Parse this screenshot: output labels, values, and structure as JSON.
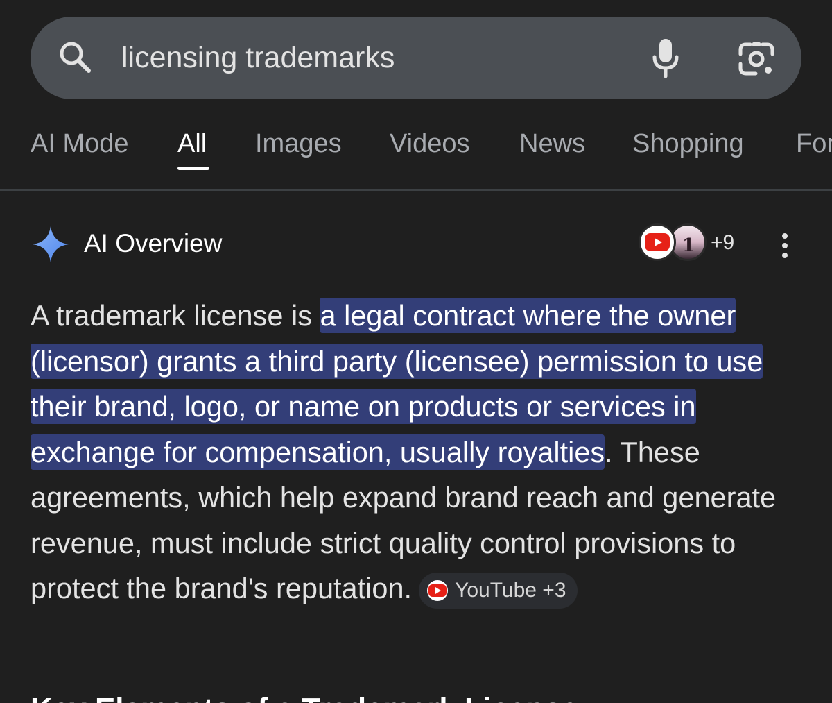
{
  "search": {
    "query": "licensing trademarks"
  },
  "icons": {
    "search": "search-icon",
    "mic": "microphone-icon",
    "lens": "google-lens-icon",
    "sparkle": "ai-sparkle-icon",
    "more": "more-vertical-icon",
    "youtube": "youtube-icon"
  },
  "tabs": [
    {
      "label": "AI Mode",
      "active": false
    },
    {
      "label": "All",
      "active": true
    },
    {
      "label": "Images",
      "active": false
    },
    {
      "label": "Videos",
      "active": false
    },
    {
      "label": "News",
      "active": false
    },
    {
      "label": "Shopping",
      "active": false
    },
    {
      "label": "Forums",
      "active": false
    }
  ],
  "overview": {
    "title": "AI Overview",
    "source_count": "+9",
    "intro": "A trademark license is ",
    "highlighted": "a legal contract where the owner (licensor) grants a third party (licensee) permission to use their brand, logo, or name on products or services in exchange for compensation, usually royalties",
    "rest": ". These agreements, which help expand brand reach and generate revenue, must include strict quality control provisions to protect the brand's reputation.",
    "chip_label": "YouTube +3",
    "next_heading": "Key Elements of a Trademark License"
  },
  "colors": {
    "background": "#1f1f1f",
    "search_bar": "#4b4f54",
    "highlight": "#333e78",
    "sparkle": "#6d9cf5",
    "youtube_red": "#e62117"
  }
}
